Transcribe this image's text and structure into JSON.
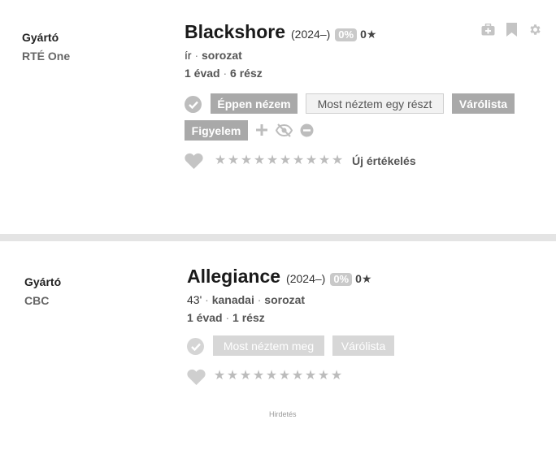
{
  "cards": [
    {
      "maker_label": "Gyártó",
      "maker": "RTÉ One",
      "title": "Blackshore",
      "year": "(2024–)",
      "percent": "0%",
      "votes": "0★",
      "meta1": {
        "tag1": "ír",
        "sep": "·",
        "tag2": "sorozat"
      },
      "meta2": {
        "seasons": "1 évad",
        "sep": "·",
        "episodes": "6 rész"
      },
      "buttons": {
        "watching": "Éppen nézem",
        "seen_episode": "Most néztem egy részt",
        "watchlist": "Várólista",
        "follow": "Figyelem"
      },
      "stars": [
        "★",
        "★",
        "★",
        "★",
        "★",
        "★",
        "★",
        "★",
        "★",
        "★"
      ],
      "rate_label": "Új értékelés",
      "icons": [
        "briefcase-medical-icon",
        "bookmark-icon",
        "gear-icon",
        "heart-icon",
        "check-circle-icon",
        "plus-icon",
        "eye-slash-icon",
        "minus-circle-icon"
      ]
    },
    {
      "maker_label": "Gyártó",
      "maker": "CBC",
      "title": "Allegiance",
      "year": "(2024–)",
      "percent": "0%",
      "votes": "0★",
      "meta1": {
        "runtime": "43'",
        "sep1": "·",
        "tag1": "kanadai",
        "sep2": "·",
        "tag2": "sorozat"
      },
      "meta2": {
        "seasons": "1 évad",
        "sep": "·",
        "episodes": "1 rész"
      },
      "buttons": {
        "seen": "Most néztem meg",
        "watchlist": "Várólista"
      },
      "stars": [
        "★",
        "★",
        "★",
        "★",
        "★",
        "★",
        "★",
        "★",
        "★",
        "★"
      ],
      "icons": [
        "check-circle-icon",
        "heart-icon"
      ]
    }
  ],
  "ad_label": "Hirdetés",
  "colors": {
    "button_dark": "#a9a9a9",
    "button_faded": "#d7d7d7",
    "star": "#bcbcbc",
    "divider": "#e4e4e4"
  }
}
